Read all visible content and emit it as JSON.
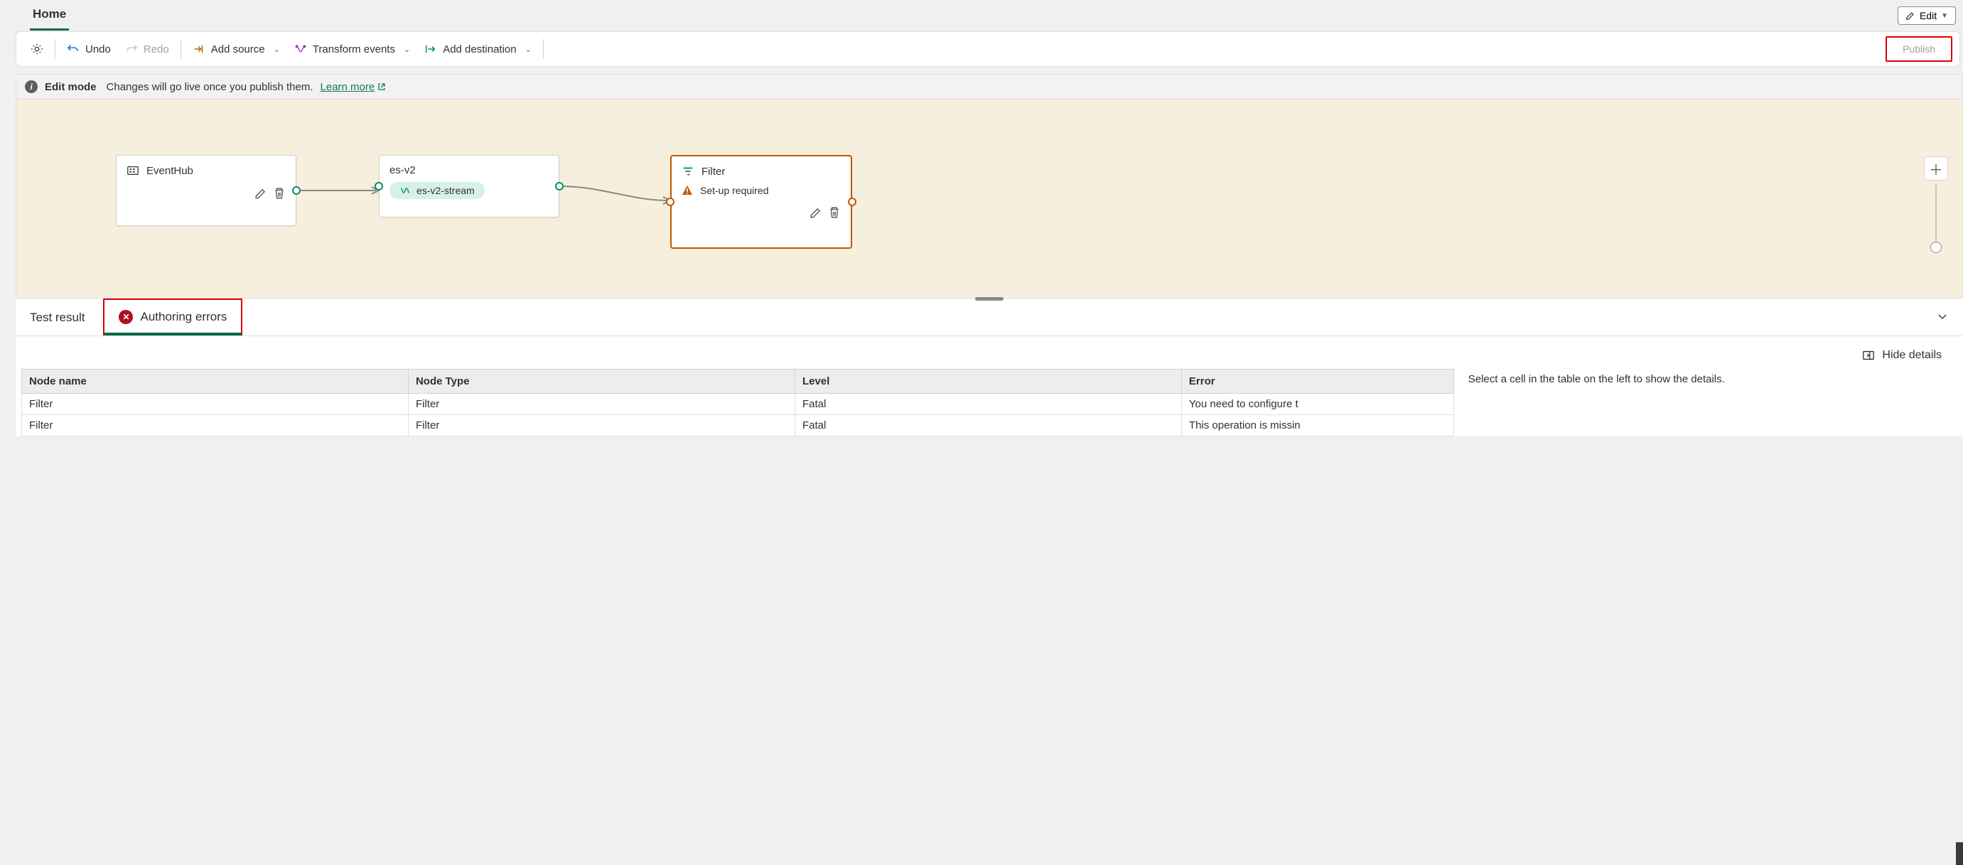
{
  "header": {
    "tab": "Home",
    "edit_label": "Edit"
  },
  "toolbar": {
    "undo": "Undo",
    "redo": "Redo",
    "add_source": "Add source",
    "transform": "Transform events",
    "add_destination": "Add destination",
    "publish": "Publish"
  },
  "info_bar": {
    "mode": "Edit mode",
    "message": "Changes will go live once you publish them.",
    "learn_more": "Learn more"
  },
  "canvas": {
    "nodes": {
      "eventhub": {
        "title": "EventHub"
      },
      "esv2": {
        "title": "es-v2",
        "stream_chip": "es-v2-stream"
      },
      "filter": {
        "title": "Filter",
        "warning": "Set-up required"
      }
    }
  },
  "bottom_tabs": {
    "test_result": "Test result",
    "authoring_errors": "Authoring errors"
  },
  "details": {
    "hide_details": "Hide details",
    "help_text": "Select a cell in the table on the left to show the details."
  },
  "error_table": {
    "headers": {
      "node_name": "Node name",
      "node_type": "Node Type",
      "level": "Level",
      "error": "Error"
    },
    "rows": [
      {
        "node_name": "Filter",
        "node_type": "Filter",
        "level": "Fatal",
        "error": "You need to configure t"
      },
      {
        "node_name": "Filter",
        "node_type": "Filter",
        "level": "Fatal",
        "error": "This operation is missin"
      }
    ]
  }
}
